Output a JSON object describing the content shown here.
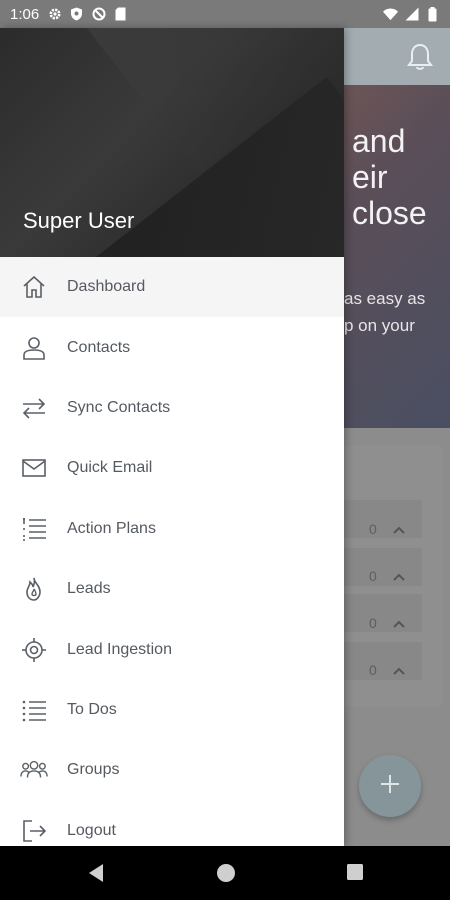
{
  "status_bar": {
    "time": "1:06",
    "left_icons": [
      "settings-icon",
      "shield-icon",
      "blocked-icon",
      "sim-icon"
    ],
    "right_icons": [
      "wifi-icon",
      "signal-icon",
      "battery-icon"
    ]
  },
  "background_app": {
    "hero_lines": [
      "and",
      "eir",
      "close"
    ],
    "hero_sub_lines": [
      "as easy as",
      "p on your"
    ],
    "counts": [
      "0",
      "0",
      "0",
      "0"
    ]
  },
  "drawer": {
    "user_name": "Super User",
    "menu": [
      {
        "label": "Dashboard",
        "icon": "home-icon",
        "active": true
      },
      {
        "label": "Contacts",
        "icon": "person-icon",
        "active": false
      },
      {
        "label": "Sync Contacts",
        "icon": "sync-arrows-icon",
        "active": false
      },
      {
        "label": "Quick Email",
        "icon": "envelope-icon",
        "active": false
      },
      {
        "label": "Action Plans",
        "icon": "numbered-list-icon",
        "active": false
      },
      {
        "label": "Leads",
        "icon": "flame-icon",
        "active": false
      },
      {
        "label": "Lead Ingestion",
        "icon": "target-icon",
        "active": false
      },
      {
        "label": "To Dos",
        "icon": "list-icon",
        "active": false
      },
      {
        "label": "Groups",
        "icon": "group-icon",
        "active": false
      },
      {
        "label": "Logout",
        "icon": "logout-icon",
        "active": false
      }
    ]
  },
  "nav_bar": {
    "buttons": [
      "back-icon",
      "home-circle-icon",
      "recents-icon"
    ]
  },
  "colors": {
    "drawer_label": "#555a60",
    "active_row": "#f5f5f5",
    "header_dark": "#2b2b2b"
  }
}
